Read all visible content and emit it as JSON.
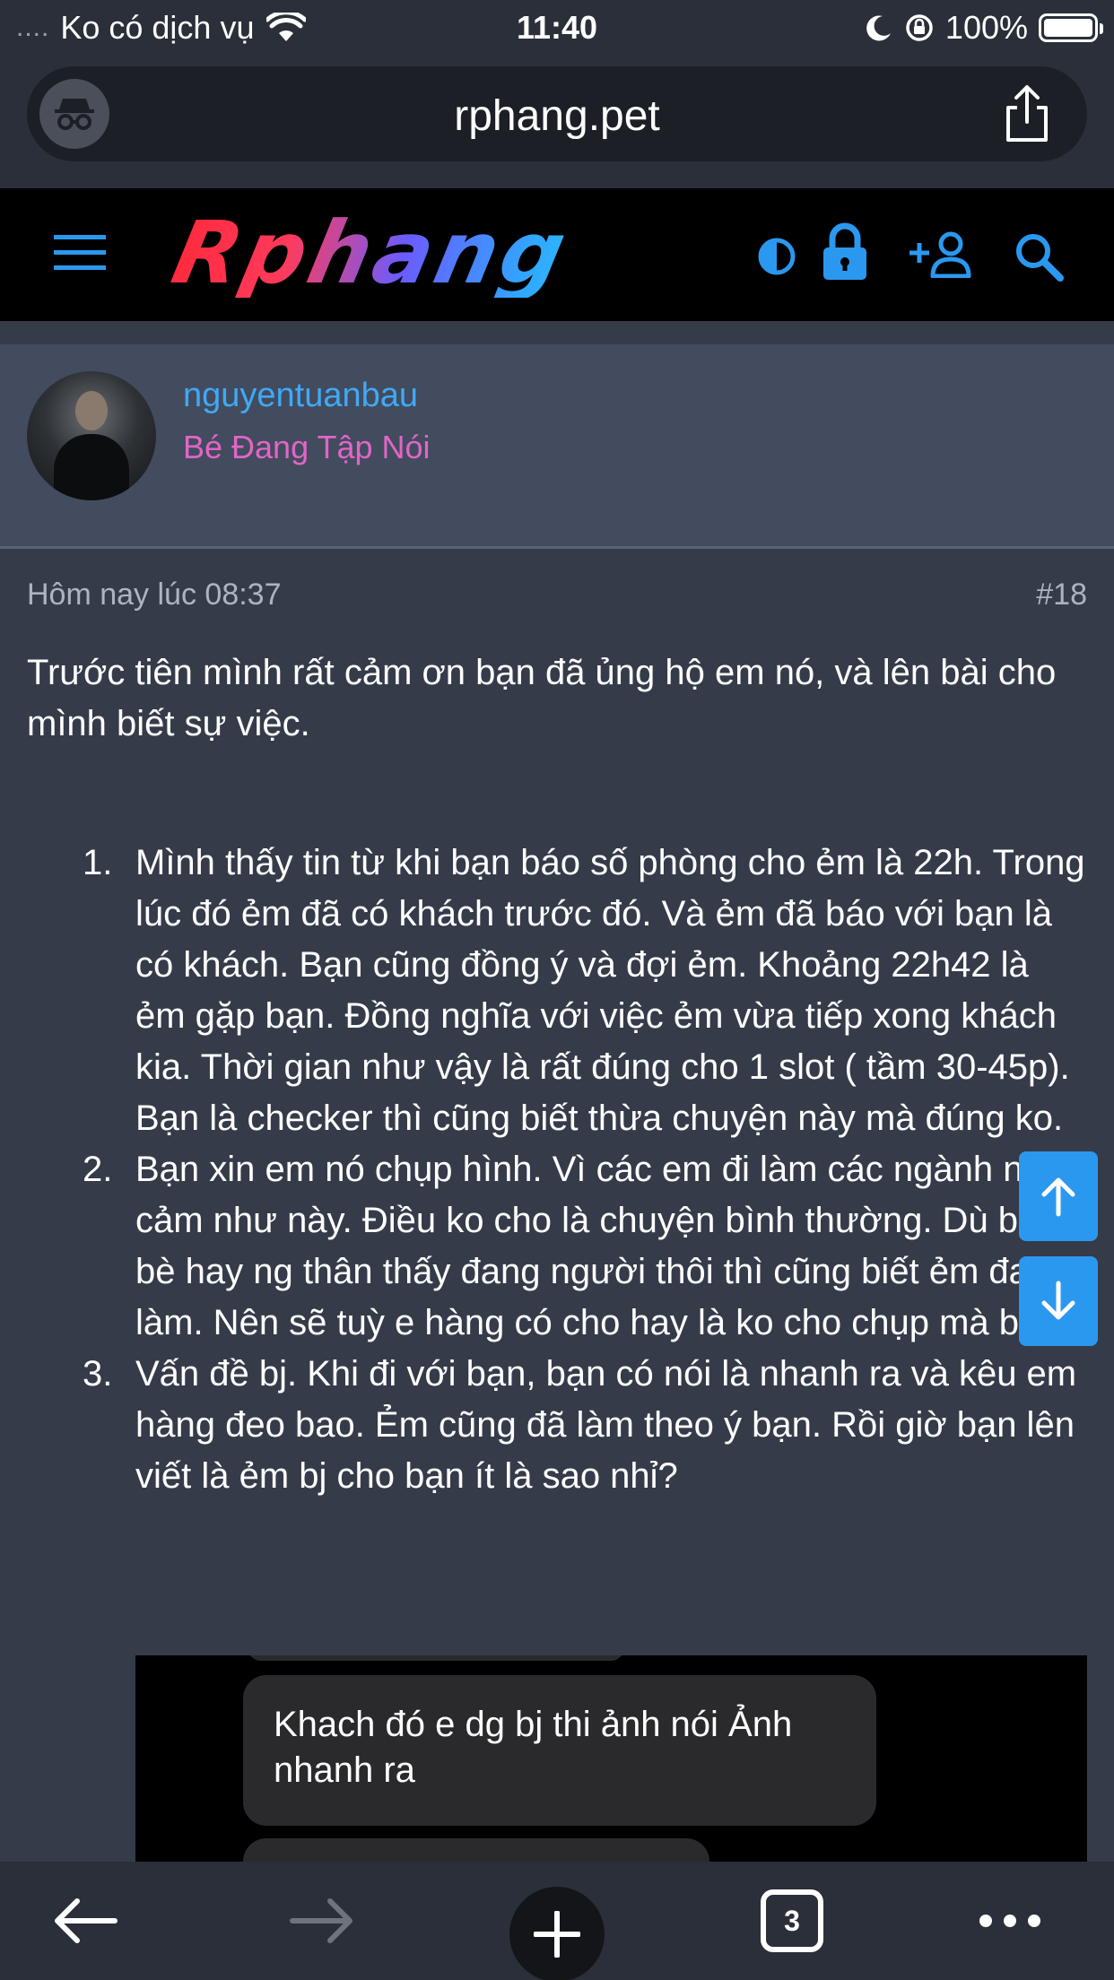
{
  "status_bar": {
    "signal_dots": "....",
    "carrier": "Ko có dịch vụ",
    "time": "11:40",
    "battery": "100%"
  },
  "browser": {
    "url": "rphang.pet",
    "tab_count": "3"
  },
  "site": {
    "logo_text": "Rphang"
  },
  "post": {
    "author": "nguyentuanbau",
    "author_title": "Bé Đang Tập Nói",
    "timestamp": "Hôm nay lúc 08:37",
    "post_number": "#18",
    "intro": "Trước tiên mình rất cảm ơn bạn đã ủng hộ em nó, và lên bài cho mình biết sự việc.",
    "list": [
      {
        "num": "1.",
        "text": "Mình thấy tin từ khi bạn báo số phòng cho ẻm là 22h. Trong lúc đó ẻm đã có khách trước đó. Và ẻm đã báo với bạn là có khách. Bạn cũng đồng ý và đợi ẻm. Khoảng 22h42 là ẻm gặp bạn. Đồng nghĩa với việc ẻm vừa tiếp xong khách kia. Thời gian như vậy là rất đúng cho 1 slot ( tầm 30-45p). Bạn là checker thì cũng biết thừa chuyện này mà đúng ko."
      },
      {
        "num": "2.",
        "text": "Bạn xin em nó chụp hình. Vì các em đi làm các ngành nhạy cảm như này. Điều ko cho là chuyện bình thường. Dù bạn bè hay ng thân thấy đang người thôi thì cũng biết ẻm đag đi làm. Nên sẽ tuỳ e hàng có cho hay là ko cho chụp mà bạn."
      },
      {
        "num": "3.",
        "text": "Vấn đề bj. Khi đi với bạn, bạn có nói là nhanh ra và kêu em hàng đeo bao. Ẻm cũng đã làm theo ý bạn. Rồi giờ bạn lên viết là ẻm bj cho bạn ít là sao nhỉ?"
      }
    ],
    "chat_message": "Khach đó e dg bj thi ảnh nói Ảnh nhanh ra"
  }
}
